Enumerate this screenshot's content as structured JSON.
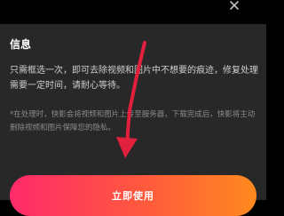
{
  "dialog": {
    "title": "信息",
    "description": "只需框选一次，即可去除视频和图片中不想要的痕迹，修复处理需要一定时间，请耐心等待。",
    "note": "*在处理时，快影会将视频和图片上传至服务器，下载完成后，快影将主动删除视频和图片保障您的隐私。",
    "cta_label": "立即使用"
  },
  "colors": {
    "background": "#000000",
    "sheet": "#282828",
    "button_gradient_start": "#ff2a6a",
    "button_gradient_end": "#ff8a1e",
    "annotation_arrow": "#e0203c"
  },
  "icons": {
    "close": "close-icon",
    "annotation": "arrow-annotation-icon"
  }
}
